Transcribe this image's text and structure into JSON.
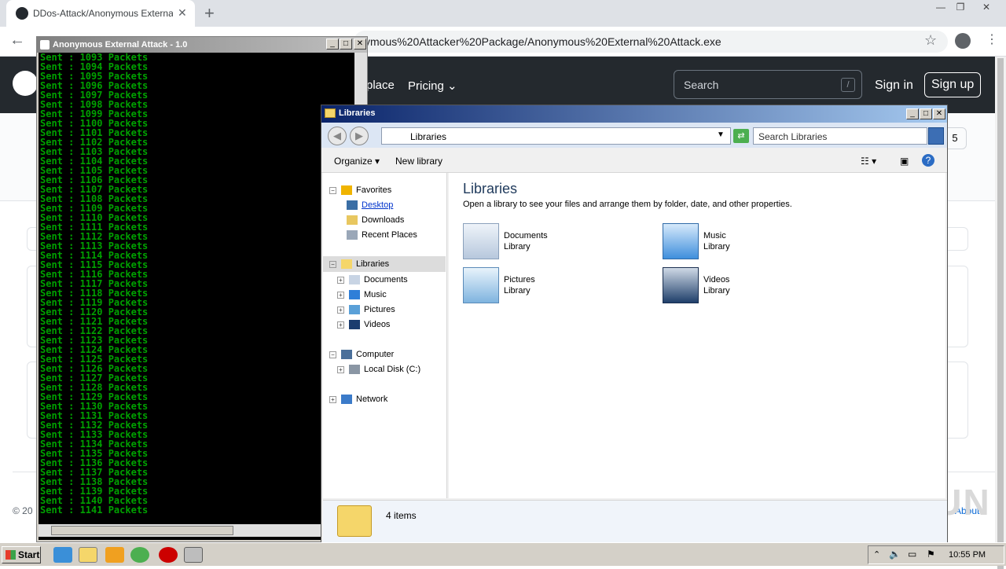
{
  "browser": {
    "tab_title": "DDos-Attack/Anonymous External A",
    "tab_close": "✕",
    "new_tab": "+",
    "url_visible": "ymous%20Attacker%20Package/Anonymous%20External%20Attack.exe"
  },
  "github": {
    "nav_marketplace": "place",
    "nav_pricing": "Pricing",
    "search_placeholder": "Search",
    "search_shortcut": "/",
    "sign_in": "Sign in",
    "sign_up": "Sign up",
    "counter": "5",
    "copyright": "© 20",
    "about": "About",
    "watermark": "ANY RUN"
  },
  "console": {
    "title": "Anonymous External Attack - 1.0",
    "lines": [
      "Sent : 1093 Packets",
      "Sent : 1094 Packets",
      "Sent : 1095 Packets",
      "Sent : 1096 Packets",
      "Sent : 1097 Packets",
      "Sent : 1098 Packets",
      "Sent : 1099 Packets",
      "Sent : 1100 Packets",
      "Sent : 1101 Packets",
      "Sent : 1102 Packets",
      "Sent : 1103 Packets",
      "Sent : 1104 Packets",
      "Sent : 1105 Packets",
      "Sent : 1106 Packets",
      "Sent : 1107 Packets",
      "Sent : 1108 Packets",
      "Sent : 1109 Packets",
      "Sent : 1110 Packets",
      "Sent : 1111 Packets",
      "Sent : 1112 Packets",
      "Sent : 1113 Packets",
      "Sent : 1114 Packets",
      "Sent : 1115 Packets",
      "Sent : 1116 Packets",
      "Sent : 1117 Packets",
      "Sent : 1118 Packets",
      "Sent : 1119 Packets",
      "Sent : 1120 Packets",
      "Sent : 1121 Packets",
      "Sent : 1122 Packets",
      "Sent : 1123 Packets",
      "Sent : 1124 Packets",
      "Sent : 1125 Packets",
      "Sent : 1126 Packets",
      "Sent : 1127 Packets",
      "Sent : 1128 Packets",
      "Sent : 1129 Packets",
      "Sent : 1130 Packets",
      "Sent : 1131 Packets",
      "Sent : 1132 Packets",
      "Sent : 1133 Packets",
      "Sent : 1134 Packets",
      "Sent : 1135 Packets",
      "Sent : 1136 Packets",
      "Sent : 1137 Packets",
      "Sent : 1138 Packets",
      "Sent : 1139 Packets",
      "Sent : 1140 Packets",
      "Sent : 1141 Packets"
    ]
  },
  "explorer": {
    "title": "Libraries",
    "address": "Libraries",
    "search_placeholder": "Search Libraries",
    "organize": "Organize",
    "new_library": "New library",
    "nav": {
      "favorites": "Favorites",
      "desktop": "Desktop",
      "downloads": "Downloads",
      "recent_places": "Recent Places",
      "libraries": "Libraries",
      "documents": "Documents",
      "music": "Music",
      "pictures": "Pictures",
      "videos": "Videos",
      "computer": "Computer",
      "local_disk": "Local Disk (C:)",
      "network": "Network"
    },
    "heading": "Libraries",
    "subheading": "Open a library to see your files and arrange them by folder, date, and other properties.",
    "libraries": [
      {
        "name": "Documents",
        "type": "Library"
      },
      {
        "name": "Music",
        "type": "Library"
      },
      {
        "name": "Pictures",
        "type": "Library"
      },
      {
        "name": "Videos",
        "type": "Library"
      }
    ],
    "status": "4 items"
  },
  "taskbar": {
    "start": "Start",
    "clock": "10:55 PM"
  }
}
